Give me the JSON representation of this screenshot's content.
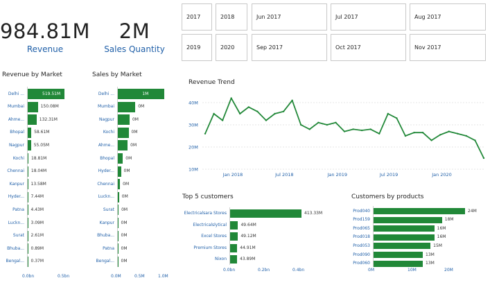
{
  "kpis": {
    "revenue": {
      "value": "984.81M",
      "label": "Revenue"
    },
    "quantity": {
      "value": "2M",
      "label": "Sales Quantity"
    }
  },
  "slicers": {
    "row1": [
      "2017",
      "2018",
      "Jun 2017",
      "Jul 2017",
      "Aug 2017"
    ],
    "row2": [
      "2019",
      "2020",
      "Sep 2017",
      "Oct 2017",
      "Nov 2017"
    ]
  },
  "revenue_by_market": {
    "title": "Revenue by Market",
    "markets": [
      "Delhi ...",
      "Mumbai",
      "Ahme...",
      "Bhopal",
      "Nagpur",
      "Kochi",
      "Chennai",
      "Kanpur",
      "Hyder...",
      "Patna",
      "Luckn...",
      "Surat",
      "Bhuba...",
      "Bengal..."
    ],
    "value_labels": [
      "519.51M",
      "150.08M",
      "132.31M",
      "58.61M",
      "55.05M",
      "18.81M",
      "18.04M",
      "13.58M",
      "7.44M",
      "4.43M",
      "3.09M",
      "2.61M",
      "0.89M",
      "0.37M"
    ],
    "values": [
      519.51,
      150.08,
      132.31,
      58.61,
      55.05,
      18.81,
      18.04,
      13.58,
      7.44,
      4.43,
      3.09,
      2.61,
      0.89,
      0.37
    ],
    "axis_ticks": [
      "0.0bn",
      "0.5bn"
    ]
  },
  "sales_by_market": {
    "title": "Sales by Market",
    "markets": [
      "Delhi ...",
      "Mumbai",
      "Nagpur",
      "Kochi",
      "Ahme...",
      "Bhopal",
      "Hyder...",
      "Chennai",
      "Luckn...",
      "Surat",
      "Kanpur",
      "Bhuba...",
      "Patna",
      "Bengal..."
    ],
    "value_labels": [
      "1M",
      "0M",
      "0M",
      "0M",
      "0M",
      "0M",
      "0M",
      "0M",
      "0M",
      "0M",
      "0M",
      "0M",
      "0M",
      "0M"
    ],
    "values": [
      0.99,
      0.38,
      0.26,
      0.24,
      0.22,
      0.12,
      0.08,
      0.06,
      0.04,
      0.03,
      0.02,
      0.02,
      0.02,
      0.01
    ],
    "axis_ticks": [
      "0.0M",
      "0.5M",
      "1.0M"
    ]
  },
  "revenue_trend": {
    "title": "Revenue Trend",
    "y_ticks": [
      "40M",
      "30M",
      "20M",
      "10M"
    ],
    "x_ticks": [
      "Jan 2018",
      "Jul 2018",
      "Jan 2019",
      "Jul 2019",
      "Jan 2020"
    ],
    "color": "#218838"
  },
  "top_customers": {
    "title": "Top 5 customers",
    "names": [
      "Electricalsara Stores",
      "Electricalslytical",
      "Excel Stores",
      "Premium Stores",
      "Nixon"
    ],
    "value_labels": [
      "413.33M",
      "49.64M",
      "49.12M",
      "44.91M",
      "43.89M"
    ],
    "values": [
      413.33,
      49.64,
      49.12,
      44.91,
      43.89
    ],
    "axis_ticks": [
      "0.0bn",
      "0.2bn",
      "0.4bn"
    ]
  },
  "customers_by_products": {
    "title": "Customers by products",
    "names": [
      "Prod040",
      "Prod159",
      "Prod065",
      "Prod018",
      "Prod053",
      "Prod090",
      "Prod060"
    ],
    "value_labels": [
      "24M",
      "18M",
      "16M",
      "16M",
      "15M",
      "13M",
      "13M"
    ],
    "values": [
      24,
      18,
      16,
      16,
      15,
      13,
      13
    ],
    "axis_ticks": [
      "0M",
      "10M",
      "20M"
    ]
  },
  "chart_data": [
    {
      "type": "bar",
      "title": "Revenue by Market",
      "categories": [
        "Delhi ...",
        "Mumbai",
        "Ahme...",
        "Bhopal",
        "Nagpur",
        "Kochi",
        "Chennai",
        "Kanpur",
        "Hyder...",
        "Patna",
        "Luckn...",
        "Surat",
        "Bhuba...",
        "Bengal..."
      ],
      "values": [
        519.51,
        150.08,
        132.31,
        58.61,
        55.05,
        18.81,
        18.04,
        13.58,
        7.44,
        4.43,
        3.09,
        2.61,
        0.89,
        0.37
      ],
      "unit": "M"
    },
    {
      "type": "bar",
      "title": "Sales by Market",
      "categories": [
        "Delhi ...",
        "Mumbai",
        "Nagpur",
        "Kochi",
        "Ahme...",
        "Bhopal",
        "Hyder...",
        "Chennai",
        "Luckn...",
        "Surat",
        "Kanpur",
        "Bhuba...",
        "Patna",
        "Bengal..."
      ],
      "values": [
        0.99,
        0.38,
        0.26,
        0.24,
        0.22,
        0.12,
        0.08,
        0.06,
        0.04,
        0.03,
        0.02,
        0.02,
        0.02,
        0.01
      ],
      "unit": "M"
    },
    {
      "type": "line",
      "title": "Revenue Trend",
      "x": [
        "Oct 2017",
        "Nov 2017",
        "Dec 2017",
        "Jan 2018",
        "Feb 2018",
        "Mar 2018",
        "Apr 2018",
        "May 2018",
        "Jun 2018",
        "Jul 2018",
        "Aug 2018",
        "Sep 2018",
        "Oct 2018",
        "Nov 2018",
        "Dec 2018",
        "Jan 2019",
        "Feb 2019",
        "Mar 2019",
        "Apr 2019",
        "May 2019",
        "Jun 2019",
        "Jul 2019",
        "Aug 2019",
        "Sep 2019",
        "Oct 2019",
        "Nov 2019",
        "Dec 2019",
        "Jan 2020",
        "Feb 2020",
        "Mar 2020",
        "Apr 2020",
        "May 2020",
        "Jun 2020"
      ],
      "values": [
        26,
        35,
        32,
        42,
        35,
        38,
        36,
        32,
        35,
        36,
        41,
        30,
        28,
        31,
        30,
        31,
        27,
        28,
        27.5,
        28,
        26,
        35,
        33,
        25,
        26.5,
        26.5,
        23,
        25.5,
        27,
        26,
        25,
        23,
        15
      ],
      "ylim": [
        10,
        45
      ],
      "unit": "M"
    },
    {
      "type": "bar",
      "title": "Top 5 customers",
      "categories": [
        "Electricalsara Stores",
        "Electricalslytical",
        "Excel Stores",
        "Premium Stores",
        "Nixon"
      ],
      "values": [
        413.33,
        49.64,
        49.12,
        44.91,
        43.89
      ],
      "unit": "M"
    },
    {
      "type": "bar",
      "title": "Customers by products",
      "categories": [
        "Prod040",
        "Prod159",
        "Prod065",
        "Prod018",
        "Prod053",
        "Prod090",
        "Prod060"
      ],
      "values": [
        24,
        18,
        16,
        16,
        15,
        13,
        13
      ],
      "unit": "M"
    }
  ]
}
